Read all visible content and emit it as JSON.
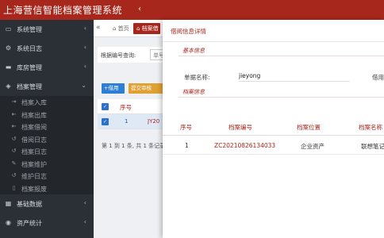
{
  "app": {
    "title": "上海营信智能档案管理系统",
    "toggle_icon": "chevron-left-icon"
  },
  "sidebar": {
    "items": [
      {
        "label": "系统管理",
        "icon": "desktop-icon",
        "expanded": false
      },
      {
        "label": "系统日志",
        "icon": "gear-icon",
        "expanded": false
      },
      {
        "label": "库房管理",
        "icon": "folder-icon",
        "expanded": false
      },
      {
        "label": "档案管理",
        "icon": "tag-icon",
        "expanded": true
      }
    ],
    "subitems": [
      {
        "label": "档案入库",
        "icon": "login-icon"
      },
      {
        "label": "档案出库",
        "icon": "logout-icon"
      },
      {
        "label": "档案借阅",
        "icon": "logout-icon"
      },
      {
        "label": "借阅日志",
        "icon": "history-icon"
      },
      {
        "label": "档案日志",
        "icon": "history-icon"
      },
      {
        "label": "档案维护",
        "icon": "wrench-icon"
      },
      {
        "label": "维护日志",
        "icon": "history-icon"
      },
      {
        "label": "档案报废",
        "icon": "trash-icon"
      }
    ],
    "bottom_items": [
      {
        "label": "基础数据",
        "icon": "grid-icon",
        "expanded": false
      },
      {
        "label": "资产统计",
        "icon": "globe-icon",
        "expanded": false
      }
    ]
  },
  "tabs": {
    "back_icon": "double-chevron-left-icon",
    "home": "首页",
    "active": "档案借"
  },
  "search": {
    "label": "根据编号查询:",
    "placeholder": "单号"
  },
  "toolbar": {
    "add_label": "+借用",
    "submit_label": "提交审核"
  },
  "list": {
    "header_seq": "序号",
    "rows": [
      {
        "seq": "1",
        "code": "JY20"
      }
    ],
    "pager": "第 1 到 1 条, 共 1 条记录"
  },
  "modal": {
    "title": "借阅信息详情",
    "basic_section": "基本信息",
    "field_label": "单据名称:",
    "field_value": "jieyong",
    "field_label2": "借用",
    "detail_section": "档案信息",
    "detail_columns": [
      "序号",
      "档案编号",
      "档案位置",
      "档案名称"
    ],
    "detail_rows": [
      {
        "seq": "1",
        "code": "ZC20210826134033",
        "location": "企业资产",
        "name": "联想笔记本"
      }
    ]
  },
  "colors": {
    "brand": "#a8271c",
    "sidebar_bg": "#2b3036",
    "link_blue": "#2d5a9a",
    "primary_button": "#2d7fd6",
    "warning_button": "#e0a032"
  }
}
